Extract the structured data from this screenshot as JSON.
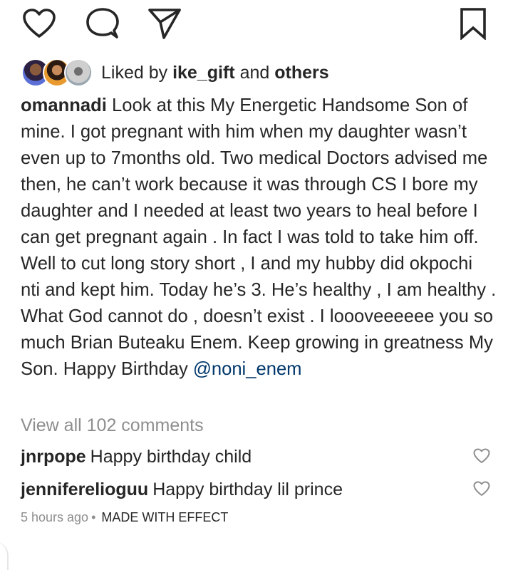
{
  "actions": {
    "like_icon": "heart-outline-icon",
    "comment_icon": "speech-bubble-icon",
    "share_icon": "paper-plane-icon",
    "save_icon": "bookmark-icon"
  },
  "likes": {
    "prefix": "Liked by",
    "first_user": "ike_gift",
    "connector": "and",
    "others": "others"
  },
  "caption": {
    "username": "omannadi",
    "text": "Look at this My Energetic Handsome Son of mine. I got pregnant with him when my daughter wasn’t even up to 7months old. Two medical Doctors advised me then, he can’t work because it was through CS I bore my daughter and I needed at least two years to heal before I can get pregnant again . In fact I was told to take him off. Well to cut long story short , I and my hubby did okpochi nti and kept him. Today he’s 3. He’s healthy , I am healthy . What God cannot do , doesn’t exist . I loooveeeeee you so much Brian Buteaku Enem. Keep growing in greatness My Son. Happy Birthday",
    "mention": "@noni_enem"
  },
  "view_all_comments": "View all 102 comments",
  "comments": [
    {
      "username": "jnrpope",
      "text": "Happy birthday child"
    },
    {
      "username": "jenniferelioguu",
      "text": "Happy birthday lil prince"
    }
  ],
  "meta": {
    "time": "5 hours ago",
    "separator": "•",
    "effect": "MADE WITH EFFECT"
  },
  "colors": {
    "text": "#262626",
    "muted": "#8e8e8e",
    "mention": "#00376b"
  }
}
